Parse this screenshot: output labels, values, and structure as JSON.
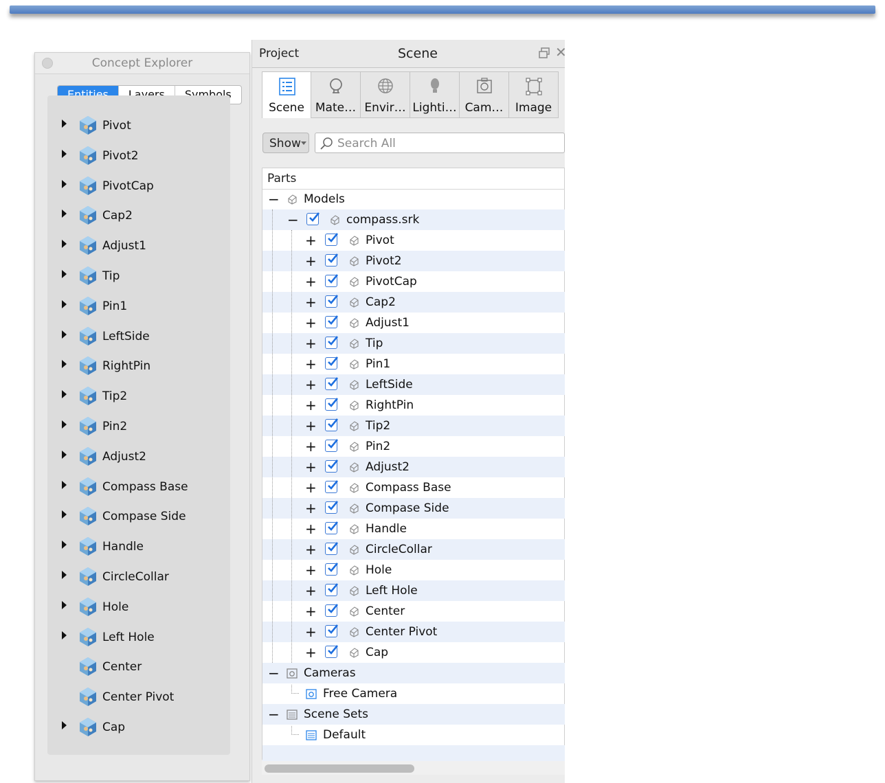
{
  "concept_explorer": {
    "title": "Concept Explorer",
    "tabs": [
      "Entities",
      "Layers",
      "Symbols"
    ],
    "active_tab": "Entities",
    "entities": [
      {
        "label": "Pivot",
        "expandable": true
      },
      {
        "label": "Pivot2",
        "expandable": true
      },
      {
        "label": "PivotCap",
        "expandable": true
      },
      {
        "label": "Cap2",
        "expandable": true
      },
      {
        "label": "Adjust1",
        "expandable": true
      },
      {
        "label": "Tip",
        "expandable": true
      },
      {
        "label": "Pin1",
        "expandable": true
      },
      {
        "label": "LeftSide",
        "expandable": true
      },
      {
        "label": "RightPin",
        "expandable": true
      },
      {
        "label": "Tip2",
        "expandable": true
      },
      {
        "label": "Pin2",
        "expandable": true
      },
      {
        "label": "Adjust2",
        "expandable": true
      },
      {
        "label": "Compass Base",
        "expandable": true
      },
      {
        "label": "Compase Side",
        "expandable": true
      },
      {
        "label": "Handle",
        "expandable": true
      },
      {
        "label": "CircleCollar",
        "expandable": true
      },
      {
        "label": "Hole",
        "expandable": true
      },
      {
        "label": "Left Hole",
        "expandable": true
      },
      {
        "label": "Center",
        "expandable": false
      },
      {
        "label": "Center Pivot",
        "expandable": false
      },
      {
        "label": "Cap",
        "expandable": true
      }
    ]
  },
  "scene_panel": {
    "project_label": "Project",
    "title": "Scene",
    "tabs": [
      {
        "label": "Scene",
        "icon": "scene-list-icon",
        "active": true
      },
      {
        "label": "Mate…",
        "icon": "material-icon",
        "active": false
      },
      {
        "label": "Envir…",
        "icon": "environment-globe-icon",
        "active": false
      },
      {
        "label": "Lighti…",
        "icon": "lightbulb-icon",
        "active": false
      },
      {
        "label": "Cam…",
        "icon": "camera-icon",
        "active": false
      },
      {
        "label": "Image",
        "icon": "image-crop-icon",
        "active": false
      }
    ],
    "show_label": "Show",
    "search_placeholder": "Search All",
    "tree_header": "Parts",
    "models_label": "Models",
    "root_model": "compass.srk",
    "parts": [
      "Pivot",
      "Pivot2",
      "PivotCap",
      "Cap2",
      "Adjust1",
      "Tip",
      "Pin1",
      "LeftSide",
      "RightPin",
      "Tip2",
      "Pin2",
      "Adjust2",
      "Compass Base",
      "Compase Side",
      "Handle",
      "CircleCollar",
      "Hole",
      "Left Hole",
      "Center",
      "Center Pivot",
      "Cap"
    ],
    "cameras_label": "Cameras",
    "cameras": [
      "Free Camera"
    ],
    "scene_sets_label": "Scene Sets",
    "scene_sets": [
      "Default"
    ],
    "accent_color": "#2b86ea",
    "checkbox_color": "#1d6fe0",
    "alt_row_color": "#eaf0fa"
  }
}
